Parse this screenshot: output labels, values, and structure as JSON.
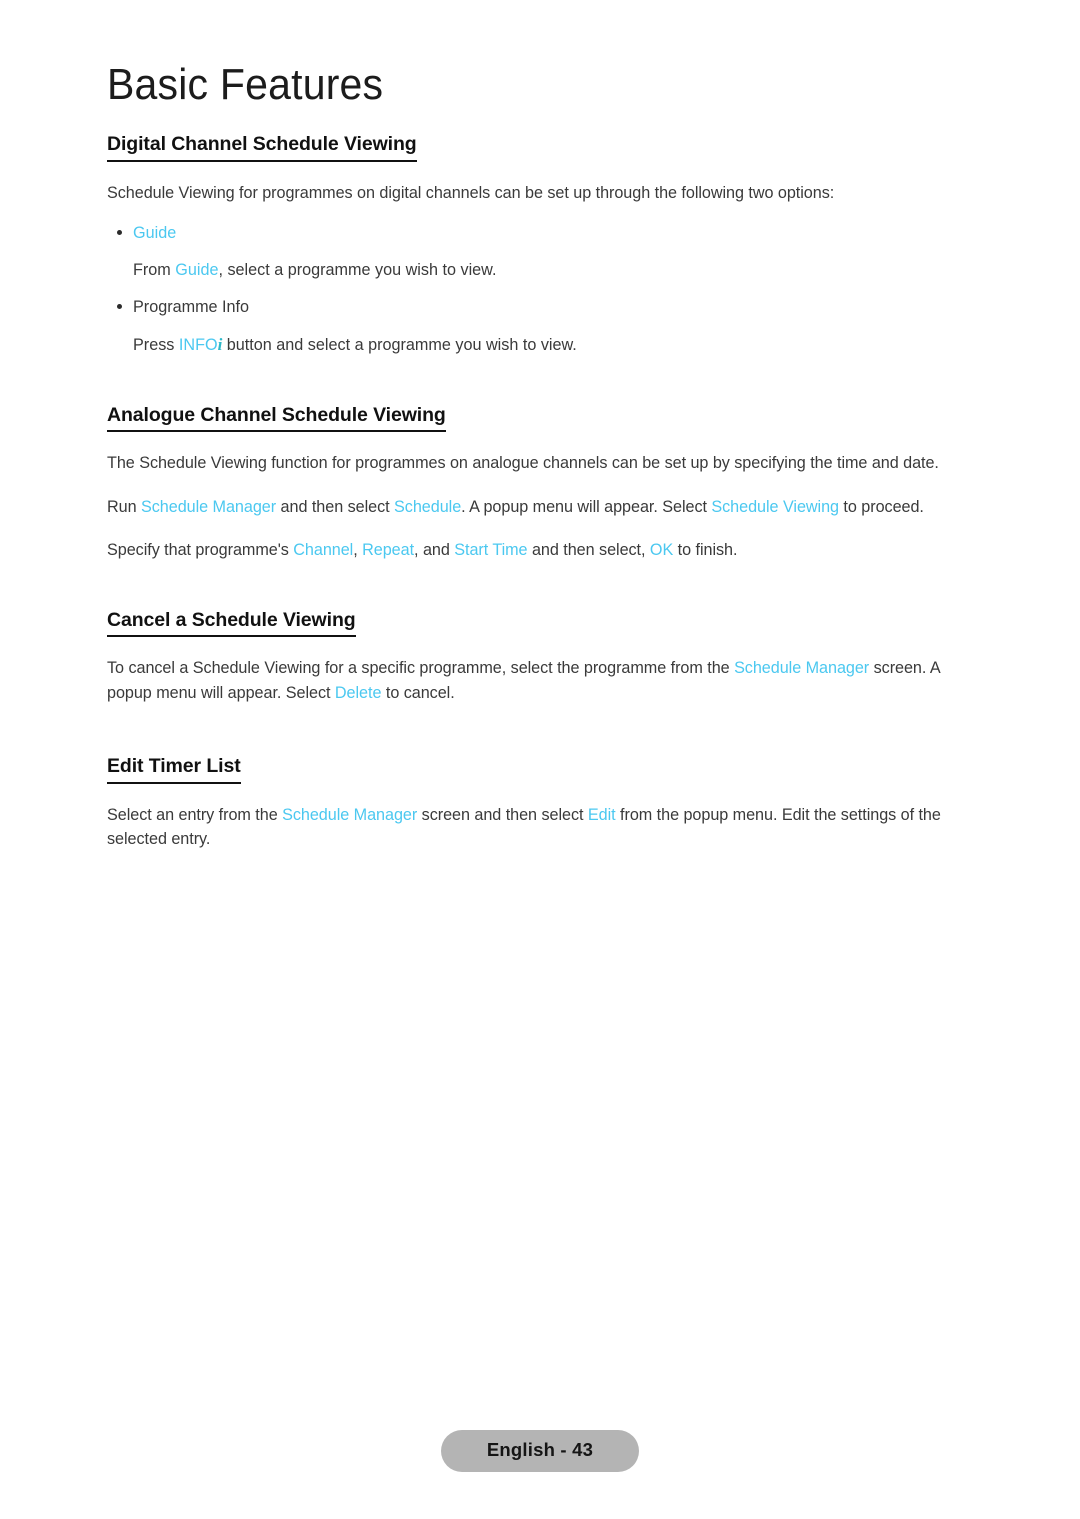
{
  "page": {
    "chapter_title": "Basic Features",
    "footer_label": "English - 43",
    "accent_color": "#4bc8f0",
    "pill_color": "#b4b4b4",
    "text_color": "#3a3a3a"
  },
  "sections": {
    "digital": {
      "heading": "Digital Channel Schedule Viewing",
      "intro": "Schedule Viewing for programmes on digital channels can be set up through the following two options:",
      "bullets": [
        {
          "label": "Guide",
          "label_highlighted": true,
          "detail_before": "From ",
          "detail_term": "Guide",
          "detail_after": ", select a programme you wish to view."
        },
        {
          "label": "Programme Info",
          "label_highlighted": false,
          "detail_before": "Press ",
          "detail_term": "INFO",
          "detail_term_suffix": "i",
          "detail_after": " button and select a programme you wish to view."
        }
      ]
    },
    "analogue": {
      "heading": "Analogue Channel Schedule Viewing",
      "para1": "The Schedule Viewing function for programmes on analogue channels can be set up by specifying the time and date.",
      "para2": {
        "t1": "Run ",
        "k1": "Schedule Manager",
        "t2": " and then select ",
        "k2": "Schedule",
        "t3": ". A popup menu will appear. Select ",
        "k3": "Schedule Viewing",
        "t4": " to proceed."
      },
      "para3": {
        "t1": "Specify that programme's ",
        "k1": "Channel",
        "t2": ", ",
        "k2": "Repeat",
        "t3": ", and ",
        "k3": "Start Time",
        "t4": " and then select, ",
        "k4": "OK",
        "t5": " to finish."
      }
    },
    "cancel": {
      "heading": "Cancel a Schedule Viewing",
      "para": {
        "t1": "To cancel a Schedule Viewing for a specific programme, select the programme from the ",
        "k1": "Schedule Manager",
        "t2": " screen. A popup menu will appear. Select ",
        "k2": "Delete",
        "t3": " to cancel."
      }
    },
    "edit_timer": {
      "heading": "Edit Timer List",
      "para": {
        "t1": "Select an entry from the ",
        "k1": "Schedule Manager",
        "t2": " screen and then select ",
        "k2": "Edit",
        "t3": " from the popup menu. Edit the settings of the selected entry."
      }
    }
  }
}
